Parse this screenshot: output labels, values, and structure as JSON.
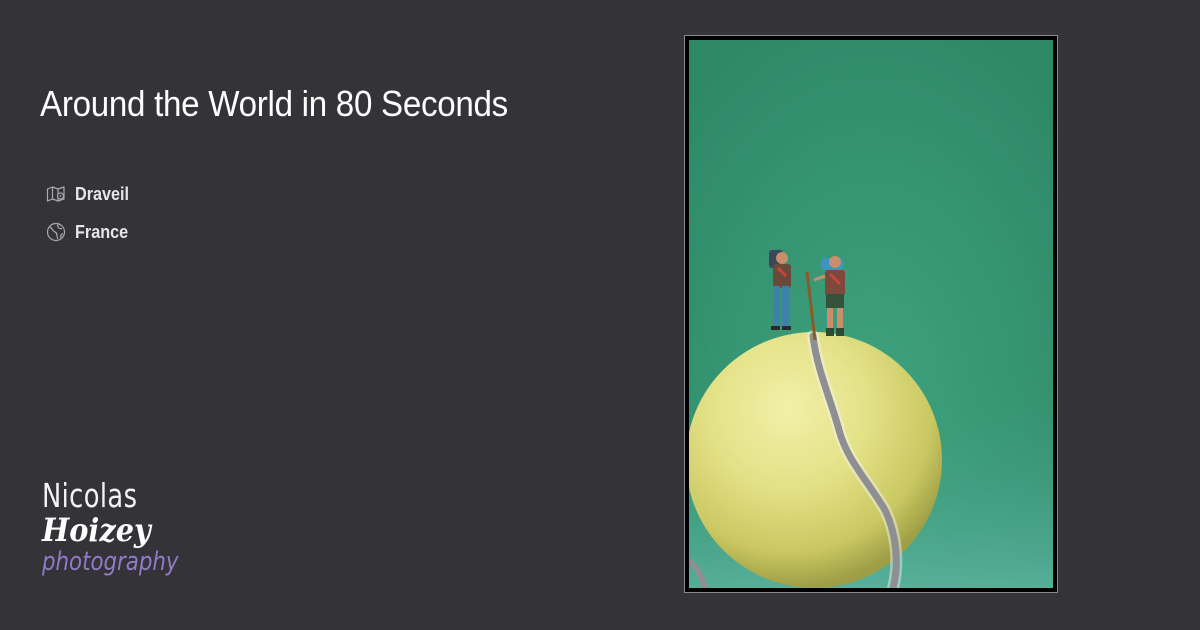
{
  "page": {
    "background": "#333338"
  },
  "title": "Around the World in 80 Seconds",
  "meta": [
    {
      "icon": "map-icon",
      "text": "Draveil"
    },
    {
      "icon": "globe-icon",
      "text": "France"
    }
  ],
  "logo": {
    "line1": "Nicolas",
    "line2": "Hoizey",
    "line3": "photography",
    "accent_color": "#8f7bc6"
  },
  "photo": {
    "description_icon": "tennis-ball-hikers-photo",
    "background_color": "#3a9a78",
    "ball_color": "#e6e68a"
  }
}
